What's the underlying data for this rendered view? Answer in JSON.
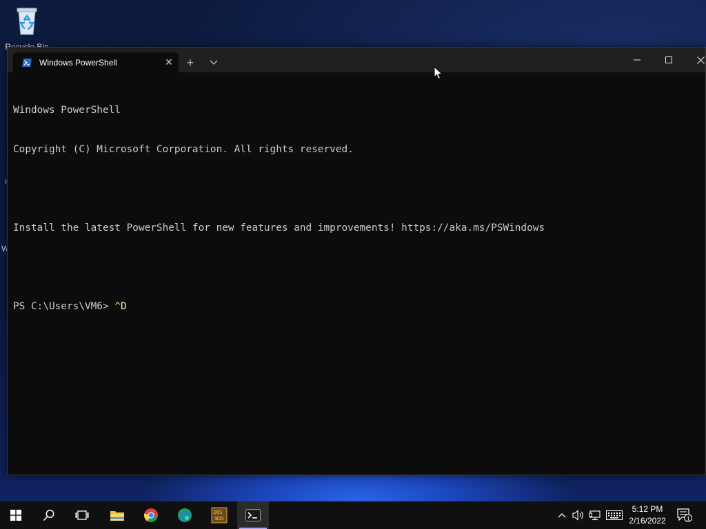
{
  "desktop": {
    "icons": [
      {
        "label": "Recycle Bin",
        "icon": "recycle-bin-icon"
      }
    ]
  },
  "window": {
    "tab": {
      "title": "Windows PowerShell",
      "icon": "powershell-icon",
      "close": "✕"
    },
    "new_tab": "+",
    "dropdown": "chevron-down-icon",
    "controls": {
      "minimize": "minimize-icon",
      "maximize": "maximize-icon",
      "close": "close-icon"
    }
  },
  "console": {
    "lines": [
      "Windows PowerShell",
      "Copyright (C) Microsoft Corporation. All rights reserved.",
      "",
      "Install the latest PowerShell for new features and improvements! https://aka.ms/PSWindows",
      ""
    ],
    "prompt": "PS C:\\Users\\VM6> ",
    "command": "^D"
  },
  "taskbar": {
    "apps": [
      {
        "name": "start",
        "icon": "windows-start-icon"
      },
      {
        "name": "search",
        "icon": "search-icon"
      },
      {
        "name": "task-view",
        "icon": "task-view-icon"
      },
      {
        "name": "file-explorer",
        "icon": "folder-icon"
      },
      {
        "name": "chrome",
        "icon": "chrome-icon"
      },
      {
        "name": "edge",
        "icon": "edge-icon"
      },
      {
        "name": "dosbox",
        "icon": "dosbox-icon"
      },
      {
        "name": "terminal",
        "icon": "terminal-icon",
        "active": true
      }
    ],
    "tray": {
      "icons": [
        "chevron-up-icon",
        "speaker-icon",
        "network-icon",
        "keyboard-icon"
      ],
      "time": "5:12 PM",
      "date": "2/16/2022",
      "notification_count": "1"
    }
  }
}
